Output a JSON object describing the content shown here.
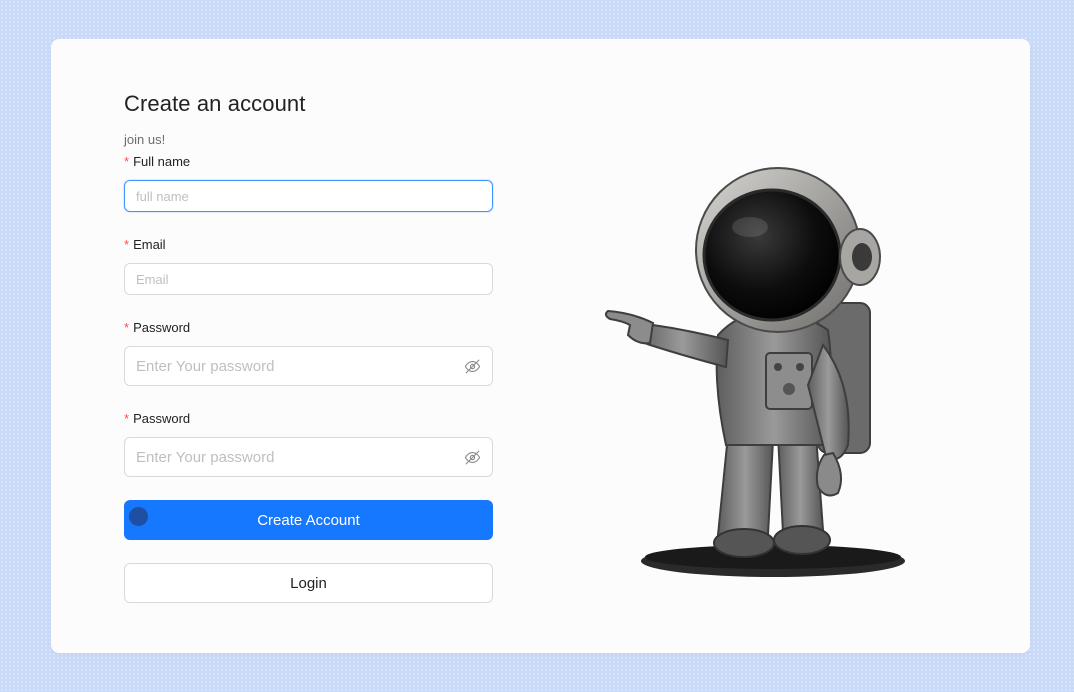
{
  "form": {
    "title": "Create an account",
    "subtitle": "join us!",
    "fields": [
      {
        "label": "Full name",
        "placeholder": "full name",
        "value": ""
      },
      {
        "label": "Email",
        "placeholder": "Email",
        "value": ""
      },
      {
        "label": "Password",
        "placeholder": "Enter Your password",
        "value": ""
      },
      {
        "label": "Password",
        "placeholder": "Enter Your password",
        "value": ""
      }
    ],
    "required_mark": "*",
    "create_button": "Create Account",
    "login_button": "Login"
  },
  "icons": {
    "password_toggle": "eye-invisible-icon",
    "illustration": "astronaut-pointing-illustration"
  },
  "colors": {
    "primary": "#1677ff",
    "required": "#ff4d4f",
    "focus_border": "#4096ff",
    "page_background": "#c9d9f8"
  }
}
